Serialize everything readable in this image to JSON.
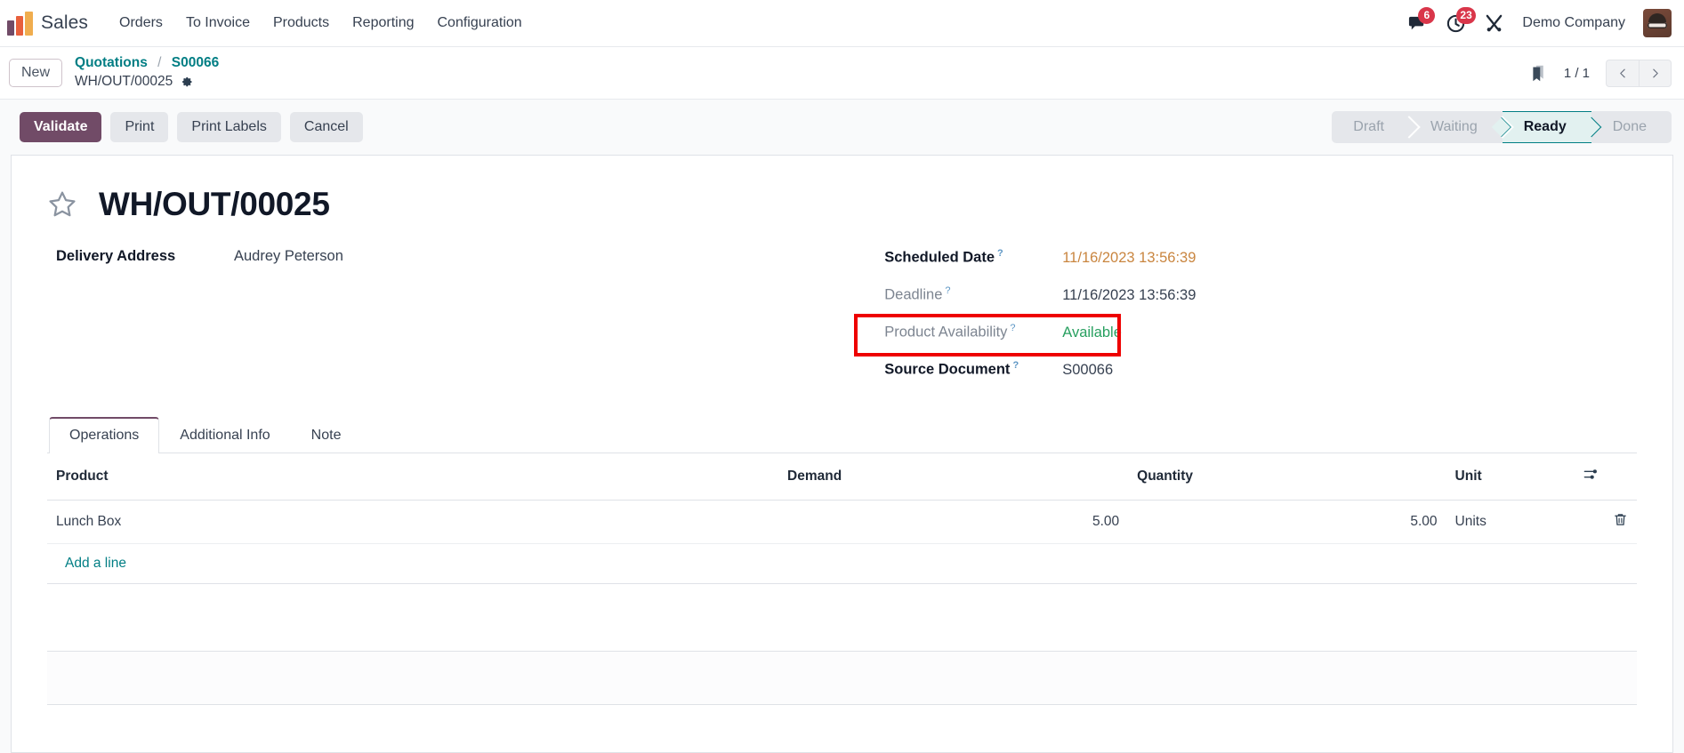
{
  "navbar": {
    "logo_name": "odoo-logo",
    "brand": "Sales",
    "menus": [
      "Orders",
      "To Invoice",
      "Products",
      "Reporting",
      "Configuration"
    ],
    "messages_badge": "6",
    "activities_badge": "23",
    "debug_icon": "tools-icon",
    "company": "Demo Company",
    "avatar_name": "user-avatar"
  },
  "breadcrumb": {
    "new_label": "New",
    "parent": "Quotations",
    "separator": "/",
    "record_link": "S00066",
    "current": "WH/OUT/00025",
    "settings_icon": "gear-icon",
    "bookmark_icon": "bookmark-icon",
    "pager": "1 / 1",
    "prev_icon": "chevron-left-icon",
    "next_icon": "chevron-right-icon"
  },
  "actions": {
    "primary": "Validate",
    "buttons": [
      "Print",
      "Print Labels",
      "Cancel"
    ]
  },
  "status": {
    "steps": [
      "Draft",
      "Waiting",
      "Ready",
      "Done"
    ],
    "active": "Ready",
    "active_color": "#017e84",
    "active_bg": "#e2f1f0"
  },
  "form": {
    "favorite_icon": "star-icon",
    "title": "WH/OUT/00025",
    "left_fields": [
      {
        "label": "Delivery Address",
        "value": "Audrey Peterson"
      }
    ],
    "right_fields": [
      {
        "label": "Scheduled Date",
        "help": "?",
        "value": "11/16/2023 13:56:39"
      },
      {
        "label": "Deadline",
        "help": "?",
        "value": "11/16/2023 13:56:39"
      },
      {
        "label": "Product Availability",
        "help": "?",
        "value": "Available"
      },
      {
        "label": "Source Document",
        "help": "?",
        "value": "S00066"
      }
    ],
    "highlight_color": "#ee0000"
  },
  "tabs": {
    "items": [
      "Operations",
      "Additional Info",
      "Note"
    ],
    "active": "Operations"
  },
  "table": {
    "columns": [
      "Product",
      "Demand",
      "Quantity",
      "Unit"
    ],
    "optional_columns_icon": "sliders-icon",
    "rows": [
      {
        "product": "Lunch Box",
        "demand": "5.00",
        "quantity": "5.00",
        "unit": "Units",
        "delete_icon": "trash-icon"
      }
    ],
    "add_line": "Add a line"
  }
}
